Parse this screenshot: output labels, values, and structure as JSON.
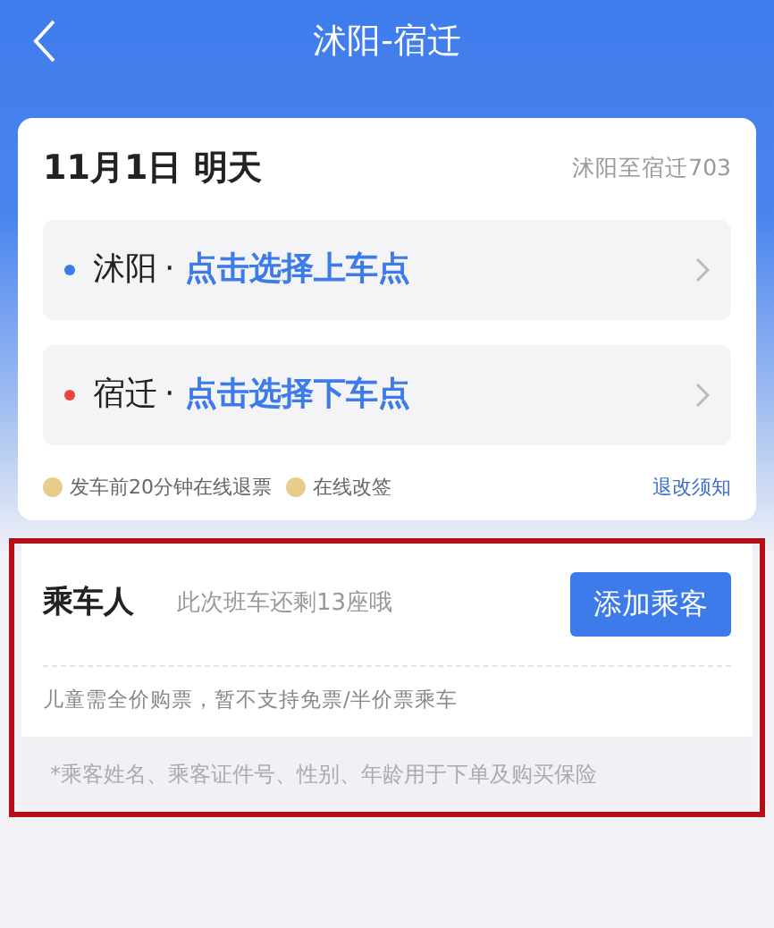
{
  "header": {
    "title": "沭阳-宿迁"
  },
  "trip": {
    "date": "11月1日 明天",
    "route_code": "沭阳至宿迁703",
    "stops": [
      {
        "city": "沭阳",
        "separator": "·",
        "action": "点击选择上车点",
        "color": "#3d7bea"
      },
      {
        "city": "宿迁",
        "separator": "·",
        "action": "点击选择下车点",
        "color": "#e8463c"
      }
    ],
    "features": [
      "发车前20分钟在线退票",
      "在线改签"
    ],
    "notice_link": "退改须知"
  },
  "passengers": {
    "label": "乘车人",
    "seats_left": "此次班车还剩13座哦",
    "add_button": "添加乘客",
    "child_note": "儿童需全价购票，暂不支持免票/半价票乘车",
    "privacy_note": "*乘客姓名、乘客证件号、性别、年龄用于下单及购买保险",
    "highlighted": true
  }
}
